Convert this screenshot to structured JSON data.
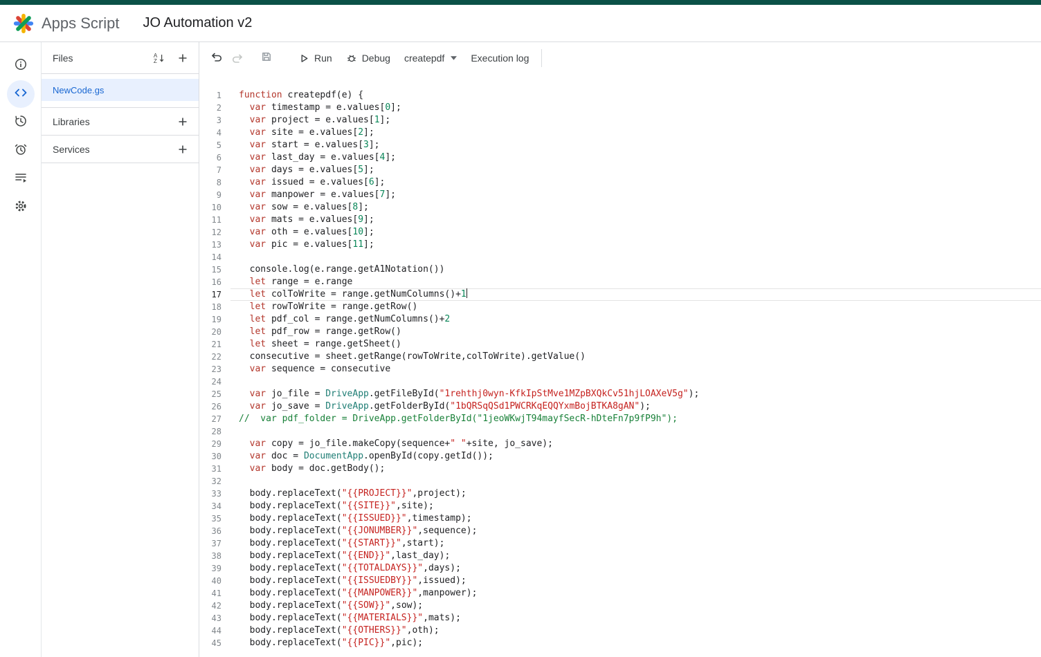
{
  "header": {
    "product": "Apps Script",
    "title": "JO Automation v2"
  },
  "rail": {
    "items": [
      {
        "id": "overview",
        "icon": "info-icon",
        "selected": false
      },
      {
        "id": "editor",
        "icon": "code-icon",
        "selected": true
      },
      {
        "id": "history",
        "icon": "history-clock-icon",
        "selected": false
      },
      {
        "id": "triggers",
        "icon": "alarm-clock-icon",
        "selected": false
      },
      {
        "id": "executions",
        "icon": "executions-list-icon",
        "selected": false
      },
      {
        "id": "settings",
        "icon": "gear-icon",
        "selected": false
      }
    ]
  },
  "sidebar": {
    "files_label": "Files",
    "files": [
      {
        "name": "NewCode.gs",
        "selected": true
      }
    ],
    "sections": [
      {
        "label": "Libraries"
      },
      {
        "label": "Services"
      }
    ]
  },
  "toolbar": {
    "run": "Run",
    "debug": "Debug",
    "selected_function": "createpdf",
    "execution_log": "Execution log"
  },
  "editor": {
    "active_line": 17,
    "show_cursor": true,
    "language": "javascript",
    "token_colors": {
      "plain": "#202124",
      "keyword": "#b3362b",
      "string": "#c5221f",
      "comment": "#188038",
      "class": "#1e7d74",
      "number": "#098658"
    },
    "lines": [
      "function createpdf(e) {",
      "  var timestamp = e.values[0];",
      "  var project = e.values[1];",
      "  var site = e.values[2];",
      "  var start = e.values[3];",
      "  var last_day = e.values[4];",
      "  var days = e.values[5];",
      "  var issued = e.values[6];",
      "  var manpower = e.values[7];",
      "  var sow = e.values[8];",
      "  var mats = e.values[9];",
      "  var oth = e.values[10];",
      "  var pic = e.values[11];",
      "",
      "  console.log(e.range.getA1Notation())",
      "  let range = e.range",
      "  let colToWrite = range.getNumColumns()+1",
      "  let rowToWrite = range.getRow()",
      "  let pdf_col = range.getNumColumns()+2",
      "  let pdf_row = range.getRow()",
      "  let sheet = range.getSheet()",
      "  consecutive = sheet.getRange(rowToWrite,colToWrite).getValue()",
      "  var sequence = consecutive",
      "",
      "  var jo_file = DriveApp.getFileById(\"1rehthj0wyn-KfkIpStMve1MZpBXQkCv51hjLOAXeV5g\");",
      "  var jo_save = DriveApp.getFolderById(\"1bQRSqQSd1PWCRKqEQQYxmBojBTKA8gAN\");",
      "//  var pdf_folder = DriveApp.getFolderById(\"1jeoWKwjT94mayfSecR-hDteFn7p9fP9h\");",
      "",
      "  var copy = jo_file.makeCopy(sequence+\" \"+site, jo_save);",
      "  var doc = DocumentApp.openById(copy.getId());",
      "  var body = doc.getBody();",
      "",
      "  body.replaceText(\"{{PROJECT}}\",project);",
      "  body.replaceText(\"{{SITE}}\",site);",
      "  body.replaceText(\"{{ISSUED}}\",timestamp);",
      "  body.replaceText(\"{{JONUMBER}}\",sequence);",
      "  body.replaceText(\"{{START}}\",start);",
      "  body.replaceText(\"{{END}}\",last_day);",
      "  body.replaceText(\"{{TOTALDAYS}}\",days);",
      "  body.replaceText(\"{{ISSUEDBY}}\",issued);",
      "  body.replaceText(\"{{MANPOWER}}\",manpower);",
      "  body.replaceText(\"{{SOW}}\",sow);",
      "  body.replaceText(\"{{MATERIALS}}\",mats);",
      "  body.replaceText(\"{{OTHERS}}\",oth);",
      "  body.replaceText(\"{{PIC}}\",pic);"
    ]
  },
  "colors": {
    "top_strip": "#0b5147",
    "accent_blue": "#1967d2",
    "selection_bg": "#e8f0fe",
    "border": "#dadce0"
  }
}
